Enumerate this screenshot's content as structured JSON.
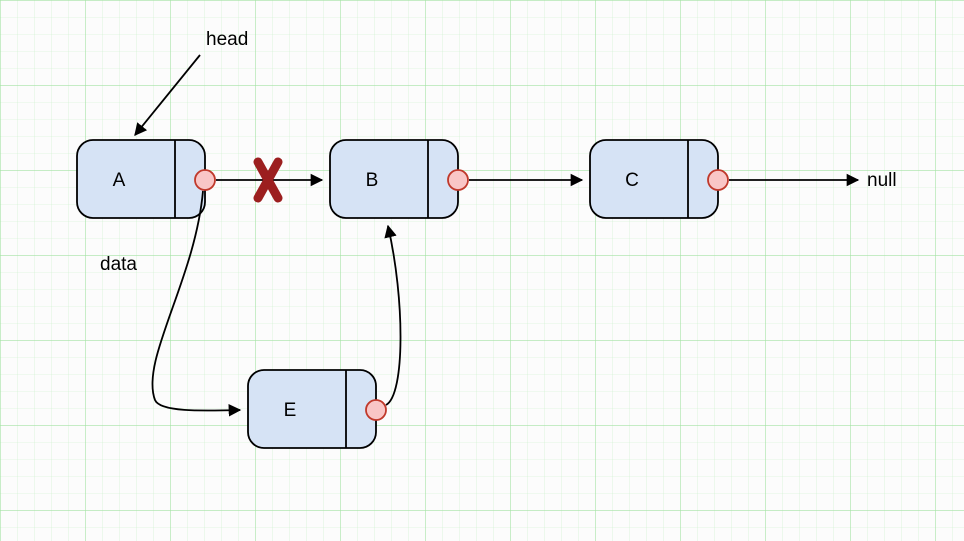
{
  "labels": {
    "head": "head",
    "data": "data",
    "null": "null"
  },
  "nodes": {
    "a": "A",
    "b": "B",
    "c": "C",
    "e": "E"
  },
  "edges": {
    "a_to_b": {
      "broken": true
    },
    "b_to_c": {
      "broken": false
    },
    "c_to_null": {
      "broken": false
    },
    "a_to_e": {
      "broken": false
    },
    "e_to_b": {
      "broken": false
    }
  },
  "diagram": {
    "type": "linked-list-insertion",
    "description": "Singly linked list with head pointing to A. Original A→B link is broken (X). New path inserts node E between A and B: A→E→B→C→null."
  }
}
